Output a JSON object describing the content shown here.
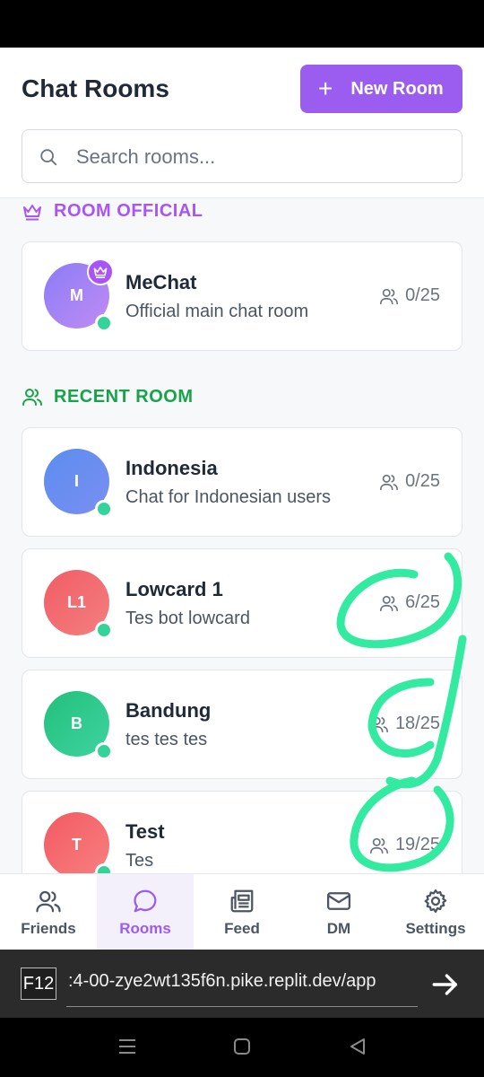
{
  "header": {
    "title": "Chat Rooms",
    "new_room_icon": "+",
    "new_room_label": "New Room",
    "search_placeholder": "Search rooms..."
  },
  "sections": {
    "official": "ROOM OFFICIAL",
    "recent": "RECENT ROOM"
  },
  "official_rooms": [
    {
      "initials": "M",
      "name": "MeChat",
      "description": "Official main chat room",
      "count": "0/25",
      "color": "#a78bfa"
    }
  ],
  "recent_rooms": [
    {
      "initials": "I",
      "name": "Indonesia",
      "description": "Chat for Indonesian users",
      "count": "0/25",
      "color": "#6b8ef5"
    },
    {
      "initials": "L1",
      "name": "Lowcard 1",
      "description": "Tes bot lowcard",
      "count": "6/25",
      "color": "#f26d72"
    },
    {
      "initials": "B",
      "name": "Bandung",
      "description": "tes tes tes",
      "count": "18/25",
      "color": "#34c98e"
    },
    {
      "initials": "T",
      "name": "Test",
      "description": "Tes",
      "count": "19/25",
      "color": "#f76b70"
    }
  ],
  "nav": [
    {
      "label": "Friends",
      "icon": "users-icon"
    },
    {
      "label": "Rooms",
      "icon": "chat-bubble-icon",
      "active": true
    },
    {
      "label": "Feed",
      "icon": "newspaper-icon"
    },
    {
      "label": "DM",
      "icon": "mail-icon"
    },
    {
      "label": "Settings",
      "icon": "gear-icon"
    }
  ],
  "browser": {
    "f12_label": "F12",
    "url": ":4-00-zye2wt135f6n.pike.replit.dev/app"
  },
  "colors": {
    "accent": "#9b5cf0",
    "official": "#a855f7",
    "recent": "#16a34a",
    "online": "#34d399",
    "scribble": "#33eba0"
  }
}
